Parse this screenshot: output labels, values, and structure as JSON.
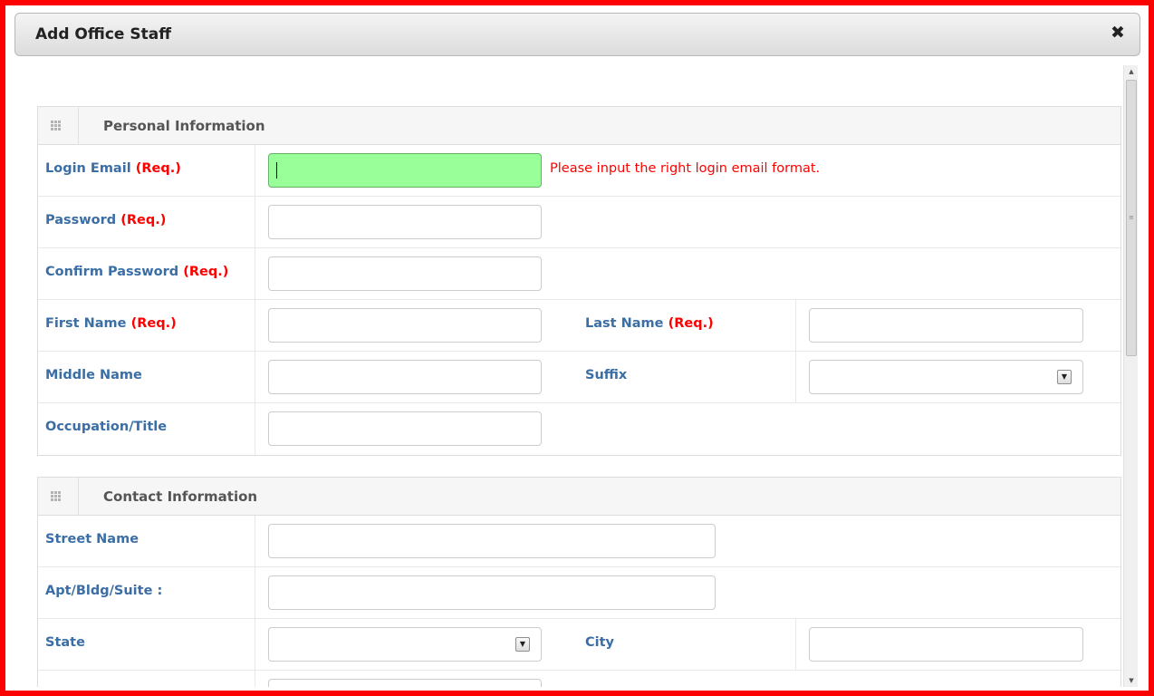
{
  "dialog": {
    "title": "Add Office Staff",
    "close_symbol": "✖"
  },
  "sections": {
    "personal": {
      "title": "Personal Information",
      "login_email_label": "Login Email",
      "login_email_value": "",
      "login_email_error": "Please input the right login email format.",
      "password_label": "Password",
      "confirm_password_label": "Confirm Password",
      "first_name_label": "First Name",
      "last_name_label": "Last Name",
      "middle_name_label": "Middle Name",
      "suffix_label": "Suffix",
      "suffix_value": "",
      "occupation_label": "Occupation/Title"
    },
    "contact": {
      "title": "Contact Information",
      "street_label": "Street Name",
      "apt_label": "Apt/Bldg/Suite :",
      "state_label": "State",
      "state_value": "",
      "city_label": "City"
    }
  },
  "required_tag": "(Req.)",
  "colors": {
    "frame_border": "#ff0000",
    "label": "#3a6ea5",
    "required": "#ff0000",
    "error": "#ff0000",
    "active_input_bg": "#99ff99"
  }
}
